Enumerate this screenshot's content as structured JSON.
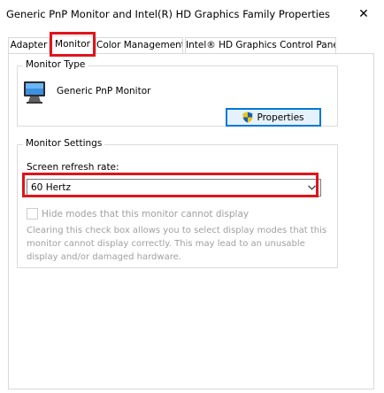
{
  "window": {
    "title": "Generic PnP Monitor and Intel(R) HD Graphics Family Properties",
    "close_glyph": "✕"
  },
  "tabs": [
    {
      "label": "Adapter"
    },
    {
      "label": "Monitor"
    },
    {
      "label": "Color Management"
    },
    {
      "label": "Intel® HD Graphics Control Panel"
    }
  ],
  "active_tab": "Monitor",
  "monitor_type": {
    "legend": "Monitor Type",
    "monitor_name": "Generic PnP Monitor",
    "icon": "monitor-icon",
    "properties_button": "Properties",
    "properties_icon": "shield-icon"
  },
  "monitor_settings": {
    "legend": "Monitor Settings",
    "refresh_label": "Screen refresh rate:",
    "refresh_value": "60 Hertz",
    "hide_modes_label": "Hide modes that this monitor cannot display",
    "hide_modes_checked": false,
    "hide_modes_enabled": false,
    "description": [
      "Clearing this check box allows you to select display modes that this",
      "monitor cannot display correctly. This may lead to an unusable",
      "display and/or damaged hardware."
    ]
  },
  "colors": {
    "highlight": "#e0141b",
    "button_border": "#0078d7",
    "button_fill": "#e5f1fb",
    "disabled_text": "#a0a0a0",
    "shield_blue": "#1a5fb4",
    "shield_yellow": "#f2c500"
  }
}
